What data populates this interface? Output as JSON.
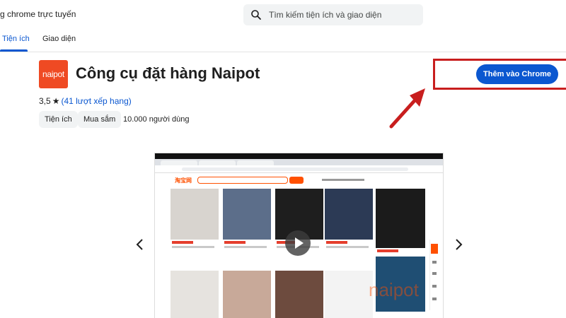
{
  "header": {
    "store_title": "g chrome trực tuyến",
    "search_placeholder": "Tìm kiếm tiện ích và giao diện"
  },
  "tabs": [
    {
      "label": "Tiện ích",
      "active": true
    },
    {
      "label": "Giao diện",
      "active": false
    }
  ],
  "extension": {
    "logo_text": "naipot",
    "logo_color": "#ef4a23",
    "title": "Công cụ đặt hàng Naipot",
    "rating_value": "3,5",
    "rating_star": "★",
    "rating_link": "(41 lượt xếp hạng)",
    "categories": [
      "Tiện ích",
      "Mua sắm"
    ],
    "users": "10.000 người dùng",
    "add_button": "Thêm vào Chrome"
  },
  "colors": {
    "accent": "#0b57d0",
    "highlight": "#c81e1e",
    "taobao": "#ff5000"
  },
  "screenshot": {
    "watermark": "naipot",
    "prev_icon": "chevron-left-icon",
    "next_icon": "chevron-right-icon"
  }
}
